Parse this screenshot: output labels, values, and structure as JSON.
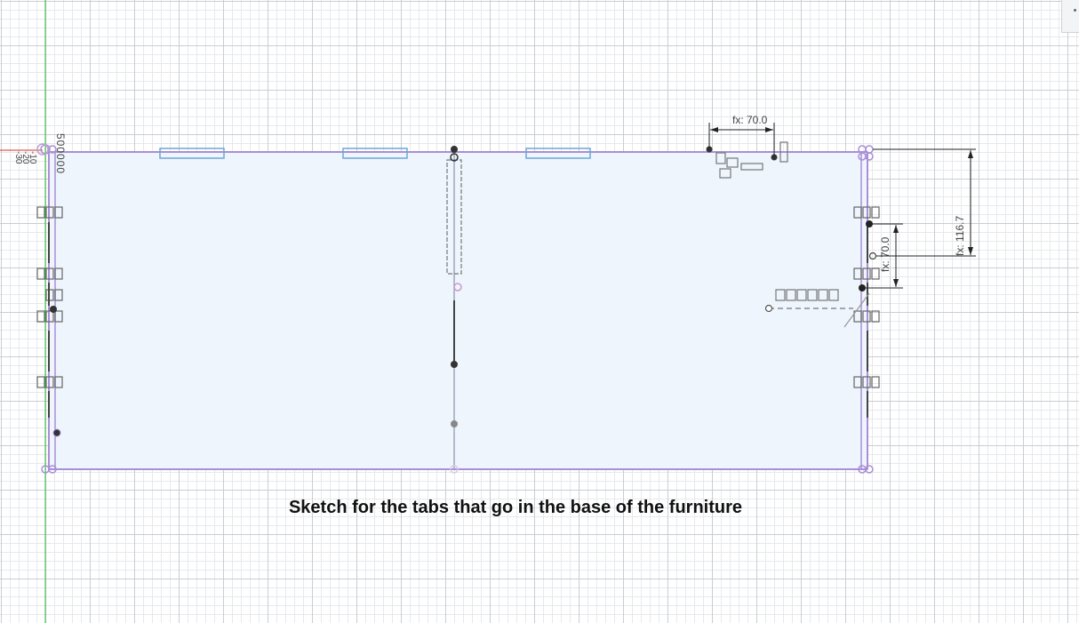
{
  "caption": "Sketch for the tabs that go in the base of the furniture",
  "origin_label": "500000",
  "axis_ticks": [
    "-10",
    "-20",
    "-30"
  ],
  "dimensions": {
    "top": "fx: 70.0",
    "right_inner": "fx: 70.0",
    "right_outer": "fx: 116.7"
  },
  "constraint_icon_names": [
    "coincident-constraint-icon",
    "horizontal-constraint-icon",
    "vertical-constraint-icon",
    "parallel-constraint-icon"
  ],
  "colors": {
    "sketch_profile_fill": "#eef5fd",
    "sketch_line": "#a98fd6",
    "construction_line": "#9ba9bb",
    "slot_outline": "#6fa7d6",
    "y_axis": "#2bbf38",
    "x_axis": "#d6342a",
    "dimension": "#222222"
  }
}
